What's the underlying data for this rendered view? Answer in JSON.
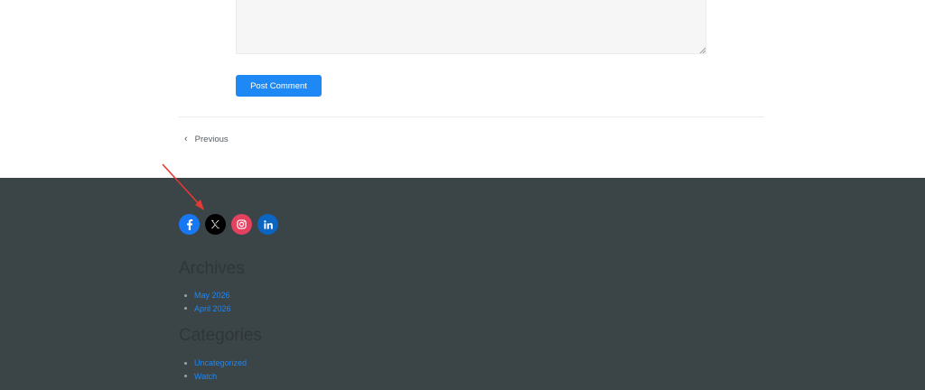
{
  "comment_form": {
    "textarea_value": "",
    "submit_label": "Post Comment"
  },
  "post_nav": {
    "previous_label": "Previous",
    "chevron": "‹"
  },
  "footer": {
    "background": "#3b4447",
    "social_icons": [
      {
        "name": "facebook-icon",
        "color": "#1877f2"
      },
      {
        "name": "x-icon",
        "color": "#000000"
      },
      {
        "name": "instagram-icon",
        "color": "#e4405f"
      },
      {
        "name": "linkedin-icon",
        "color": "#0a66c2"
      }
    ],
    "annotation_arrow_color": "#e53935",
    "archives": {
      "title": "Archives",
      "items": [
        "May 2026",
        "April 2026"
      ]
    },
    "categories": {
      "title": "Categories",
      "items": [
        "Uncategorized",
        "Watch"
      ]
    }
  },
  "accent_color": "#1e88f5"
}
